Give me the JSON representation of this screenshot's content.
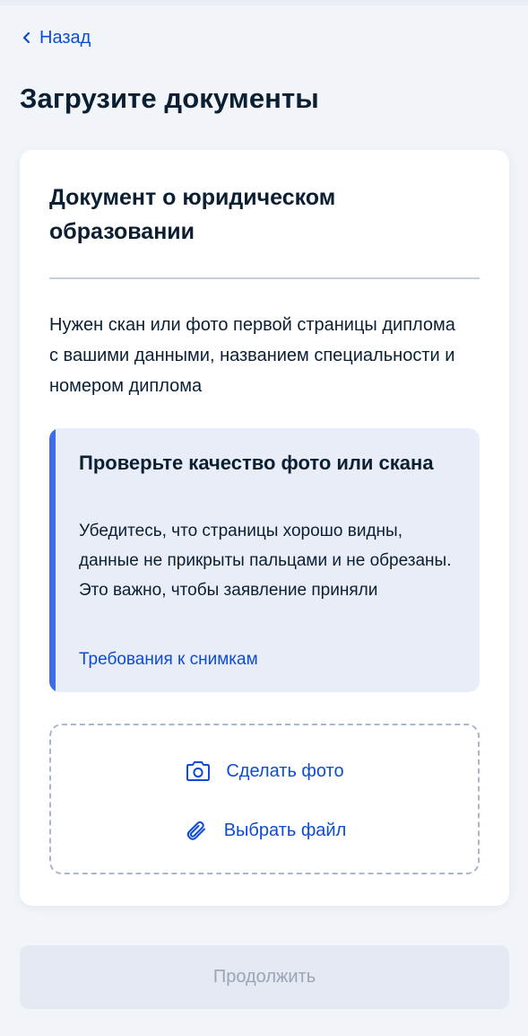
{
  "nav": {
    "back_label": "Назад"
  },
  "page": {
    "title": "Загрузите документы"
  },
  "card": {
    "title": "Документ о юридическом образовании",
    "description": "Нужен скан или фото первой страницы диплома с вашими данными, названием специальности и номером диплома",
    "notice": {
      "title": "Проверьте качество фото или скана",
      "text": "Убедитесь, что страницы хорошо видны, данные не прикрыты пальцами и не обрезаны. Это важно, чтобы заявление приняли",
      "link_label": "Требования к снимкам"
    },
    "upload": {
      "take_photo_label": "Сделать фото",
      "take_photo_icon": "camera-icon",
      "choose_file_label": "Выбрать файл",
      "choose_file_icon": "paperclip-icon"
    }
  },
  "footer": {
    "continue_label": "Продолжить",
    "continue_disabled": true
  },
  "colors": {
    "background": "#f1f4f9",
    "accent": "#0d4cd3",
    "notice_bar": "#3d6ee6",
    "notice_bg": "#e9edf8",
    "disabled_button_bg": "#e4e9f2",
    "disabled_button_text": "#9aa5b5"
  }
}
